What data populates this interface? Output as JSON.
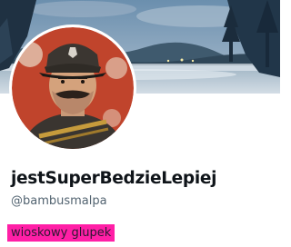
{
  "profile": {
    "display_name": "jestSuperBedzieLepiej",
    "handle": "@bambusmalpa",
    "bio": "wioskowy glupek"
  },
  "colors": {
    "name_text": "#0f1419",
    "handle_text": "#536471",
    "bio_highlight": "#ff1fa6",
    "background": "#ffffff"
  },
  "images": {
    "banner": "misty-lake-forest-banner",
    "avatar": "illustrated-mustached-soldier-avatar"
  }
}
